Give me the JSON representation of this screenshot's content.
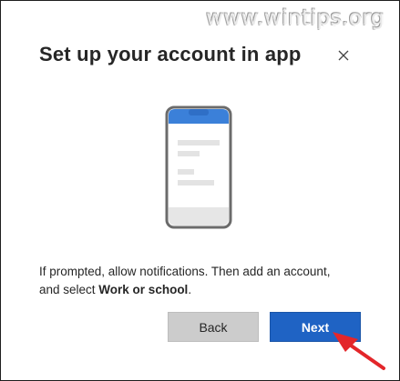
{
  "watermark": {
    "text": "www.wintips.org"
  },
  "dialog": {
    "title": "Set up your account in app",
    "close_icon": "close-icon",
    "instruction": {
      "prefix": "If prompted, allow notifications. Then add an account, and select ",
      "emphasis": "Work or school",
      "suffix": "."
    },
    "buttons": {
      "back_label": "Back",
      "next_label": "Next"
    }
  },
  "illustration": {
    "icon": "phone-illustration-icon"
  },
  "colors": {
    "primary": "#1f63c4",
    "secondary_button": "#cccccc",
    "phone_accent": "#3b80d9",
    "arrow": "#e3262a"
  }
}
